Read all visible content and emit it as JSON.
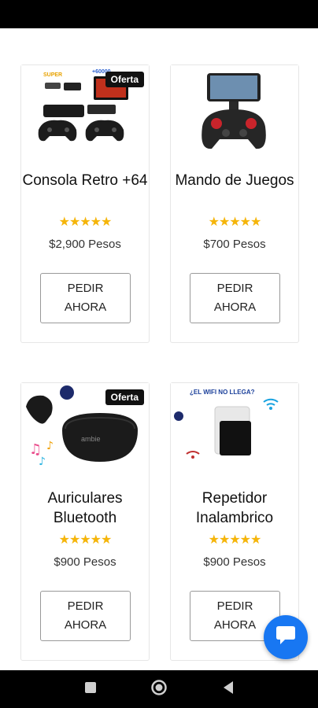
{
  "products": [
    {
      "title": "Consola Retro +64",
      "badge": "Oferta",
      "rating": "★★★★★",
      "price": "$2,900 Pesos",
      "button": "PEDIR AHORA",
      "image_label": "+60000"
    },
    {
      "title": "Mando de Juegos",
      "badge": "",
      "rating": "★★★★★",
      "price": "$700 Pesos",
      "button": "PEDIR AHORA"
    },
    {
      "title": "Auriculares Bluetooth",
      "badge": "Oferta",
      "rating": "★★★★★",
      "price": "$900 Pesos",
      "button": "PEDIR AHORA",
      "image_label": "ambie"
    },
    {
      "title": "Repetidor Inalambrico",
      "badge": "",
      "rating": "★★★★★",
      "price": "$900 Pesos",
      "button": "PEDIR AHORA",
      "image_label": "¿EL WIFI NO LLEGA?"
    }
  ],
  "colors": {
    "star": "#f5b50a",
    "chat_fab": "#1877f2",
    "badge_bg": "#111111"
  },
  "icons": {
    "chat": "chat-bubble-icon",
    "nav_recents": "square-icon",
    "nav_home": "circle-icon",
    "nav_back": "triangle-back-icon"
  }
}
